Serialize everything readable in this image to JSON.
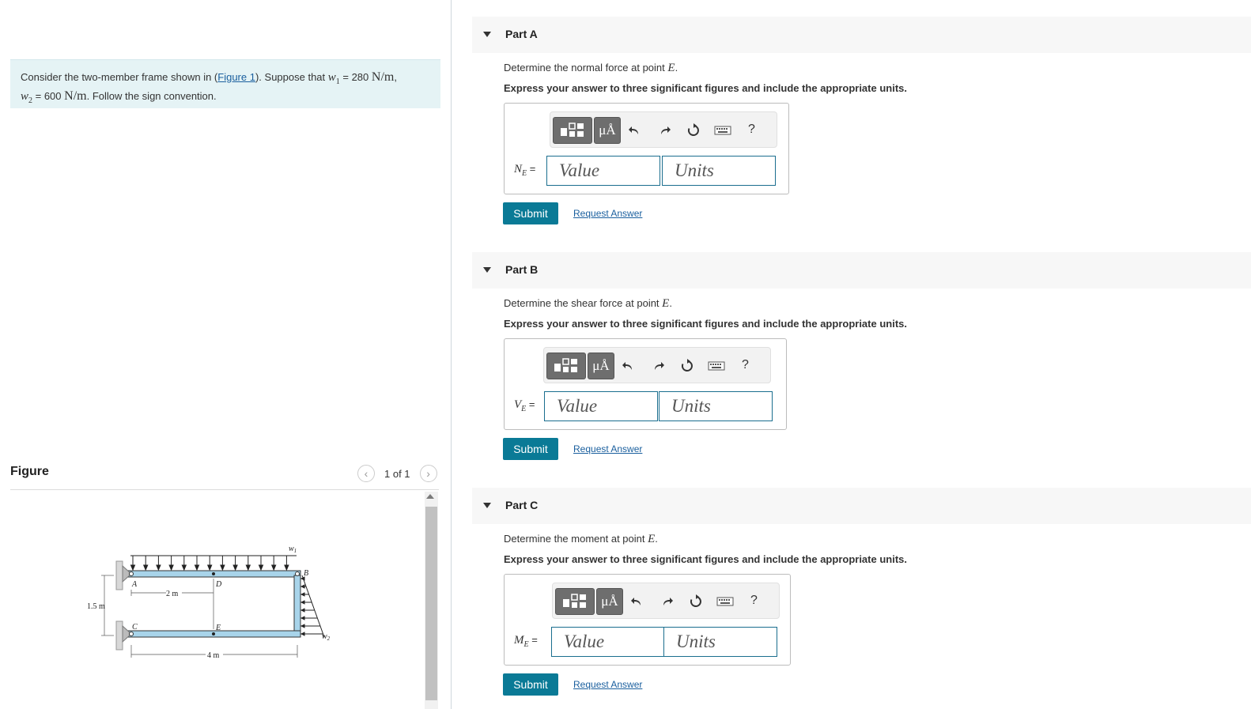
{
  "problem": {
    "text_before": "Consider the two-member frame shown in (",
    "figure_link": "Figure 1",
    "text_after": "). Suppose that ",
    "w1_symbol": "w",
    "w1_sub": "1",
    "w1_value": " = 280 ",
    "w1_unit": "N/m",
    "comma": ",",
    "w2_symbol": "w",
    "w2_sub": "2",
    "w2_value": " = 600 ",
    "w2_unit": "N/m",
    "text_end": ". Follow the sign convention."
  },
  "figure_panel": {
    "title": "Figure",
    "counter": "1 of 1",
    "prev_glyph": "‹",
    "next_glyph": "›"
  },
  "figure": {
    "labels": {
      "w1": "w",
      "w1_sub": "1",
      "w2": "w",
      "w2_sub": "2",
      "A": "A",
      "B": "B",
      "C": "C",
      "D": "D",
      "E": "E",
      "dim_2m": "2 m",
      "dim_15m": "1.5 m",
      "dim_4m": "4 m"
    },
    "colors": {
      "member_fill": "#a8d4ea",
      "member_stroke": "#333333",
      "support": "#d8d8d8"
    }
  },
  "common": {
    "instruction": "Express your answer to three significant figures and include the appropriate units.",
    "value_placeholder": "Value",
    "units_placeholder": "Units",
    "submit_label": "Submit",
    "request_label": "Request Answer",
    "mu_a": "μÅ",
    "help": "?"
  },
  "parts": [
    {
      "title": "Part A",
      "question_prefix": "Determine the normal force at point ",
      "point": "E",
      "question_suffix": ".",
      "var": "N",
      "var_sub": "E",
      "eq": " ="
    },
    {
      "title": "Part B",
      "question_prefix": "Determine the shear force at point ",
      "point": "E",
      "question_suffix": ".",
      "var": "V",
      "var_sub": "E",
      "eq": " ="
    },
    {
      "title": "Part C",
      "question_prefix": "Determine the moment at point ",
      "point": "E",
      "question_suffix": ".",
      "var": "M",
      "var_sub": "E",
      "eq": " ="
    }
  ],
  "accent_colors": {
    "submit": "#0a7a96",
    "link": "#1a5f9e",
    "problem_bg": "#e5f3f5"
  }
}
